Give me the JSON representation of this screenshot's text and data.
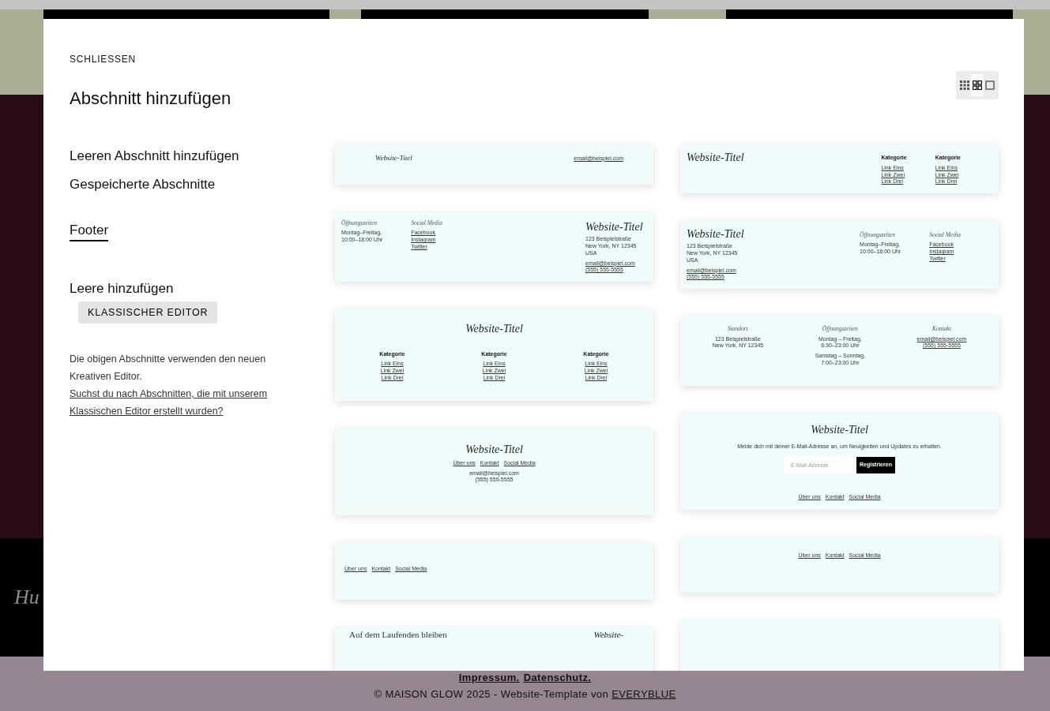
{
  "background": {
    "hero_text": "Hu",
    "footer": {
      "links": [
        "Impressum.",
        "Datenschutz."
      ],
      "credit": "© MAISON GLOW 2025 - Website-Template von",
      "credit_link": "EVERYBLUE"
    }
  },
  "modal": {
    "close": "SCHLIESSEN",
    "title": "Abschnitt hinzufügen",
    "menu": [
      {
        "label": "Leeren Abschnitt hinzufügen",
        "selected": false
      },
      {
        "label": "Gespeicherte Abschnitte",
        "selected": false
      },
      {
        "label": "Footer",
        "selected": true
      }
    ],
    "classic": {
      "label": "Leere hinzufügen",
      "button": "KLASSISCHER EDITOR"
    },
    "note": {
      "text": "Die obigen Abschnitte verwenden den neuen Kreativen Editor.",
      "link": "Suchst du nach Abschnitten, die mit unserem Klassischen Editor erstellt wurden?"
    },
    "view_toggle": [
      {
        "kind": "small-grid",
        "selected": false
      },
      {
        "kind": "large-grid",
        "selected": true
      },
      {
        "kind": "single",
        "selected": false
      }
    ],
    "columns": [
      [
        {
          "kind": "bar",
          "title": "Website-Titel",
          "links": [
            "email@beispiel.com"
          ]
        },
        {
          "kind": "columns-title",
          "columns": [
            {
              "kind": "info",
              "heading": "Öffnungszeiten",
              "paragraphs": [
                "Montag–Freitag,\n10:00–18:00 Uhr"
              ]
            },
            {
              "kind": "info",
              "heading": "Social Media",
              "links": [
                "Facebook",
                "Instagram",
                "Twitter"
              ]
            }
          ],
          "title": "Website-Titel",
          "paragraphs": [
            "123 Beispielstraße\nNew York, NY 12345\nUSA"
          ],
          "links": [
            "email@beispiel.com",
            "(555) 555-5555"
          ]
        },
        {
          "kind": "title-grid",
          "title": "Website-Titel",
          "columns": [
            {
              "kind": "category",
              "heading": "Kategorie",
              "links": [
                "Link Eins",
                "Link Zwei",
                "Link Drei"
              ]
            },
            {
              "kind": "category",
              "heading": "Kategorie",
              "links": [
                "Link Eins",
                "Link Zwei",
                "Link Drei"
              ]
            },
            {
              "kind": "category",
              "heading": "Kategorie",
              "links": [
                "Link Eins",
                "Link Zwei",
                "Link Drei"
              ]
            }
          ]
        },
        {
          "kind": "centered",
          "title": "Website-Titel",
          "nav": [
            "Über uns",
            "Kontakt",
            "Social Media"
          ],
          "paragraphs": [
            "email@beispiel.com\n(555) 555-5555"
          ]
        },
        {
          "kind": "nav-left",
          "nav": [
            "Über uns",
            "Kontakt",
            "Social Media"
          ]
        },
        {
          "kind": "partial",
          "text": "Auf dem Laufenden bleiben",
          "title": "Website-"
        }
      ],
      [
        {
          "kind": "title-columns",
          "title": "Website-Titel",
          "columns": [
            {
              "kind": "category",
              "heading": "Kategorie",
              "links": [
                "Link Eins",
                "Link Zwei",
                "Link Drei"
              ]
            },
            {
              "kind": "category",
              "heading": "Kategorie",
              "links": [
                "Link Eins",
                "Link Zwei",
                "Link Drei"
              ]
            }
          ]
        },
        {
          "kind": "title-columns",
          "title": "Website-Titel",
          "paragraphs": [
            "123 Beispielstraße\nNew York, NY 12345\nUSA"
          ],
          "links": [
            "email@beispiel.com",
            "(555) 555-5555"
          ],
          "columns": [
            {
              "kind": "info",
              "heading": "Öffnungszeiten",
              "paragraphs": [
                "Montag–Freitag,\n10:00–18:00 Uhr"
              ]
            },
            {
              "kind": "info",
              "heading": "Social Media",
              "links": [
                "Facebook",
                "Instagram",
                "Twitter"
              ]
            }
          ]
        },
        {
          "kind": "spread-columns",
          "columns": [
            {
              "kind": "info",
              "heading": "Standort",
              "paragraphs": [
                "123 Beispielstraße\nNew York, NY 12345"
              ]
            },
            {
              "kind": "info",
              "heading": "Öffnungszeiten",
              "paragraphs": [
                "Montag – Freitag,\n6:30–23:00 Uhr",
                "Samstag – Sonntag,\n7:00–23:00 Uhr"
              ]
            },
            {
              "kind": "info",
              "heading": "Kontakt",
              "links": [
                "email@beispiel.com",
                "(555) 555-5555"
              ]
            }
          ]
        },
        {
          "kind": "newsletter",
          "title": "Website-Titel",
          "text": "Melde dich mit deiner E-Mail-Adresse an, um Neuigkeiten und Updates zu erhalten.",
          "placeholder": "E-Mail-Adresse",
          "button": "Registrieren",
          "nav": [
            "Über uns",
            "Kontakt",
            "Social Media"
          ]
        },
        {
          "kind": "nav-center",
          "nav": [
            "Über uns",
            "Kontakt",
            "Social Media"
          ]
        },
        {
          "kind": "blank"
        }
      ]
    ]
  }
}
